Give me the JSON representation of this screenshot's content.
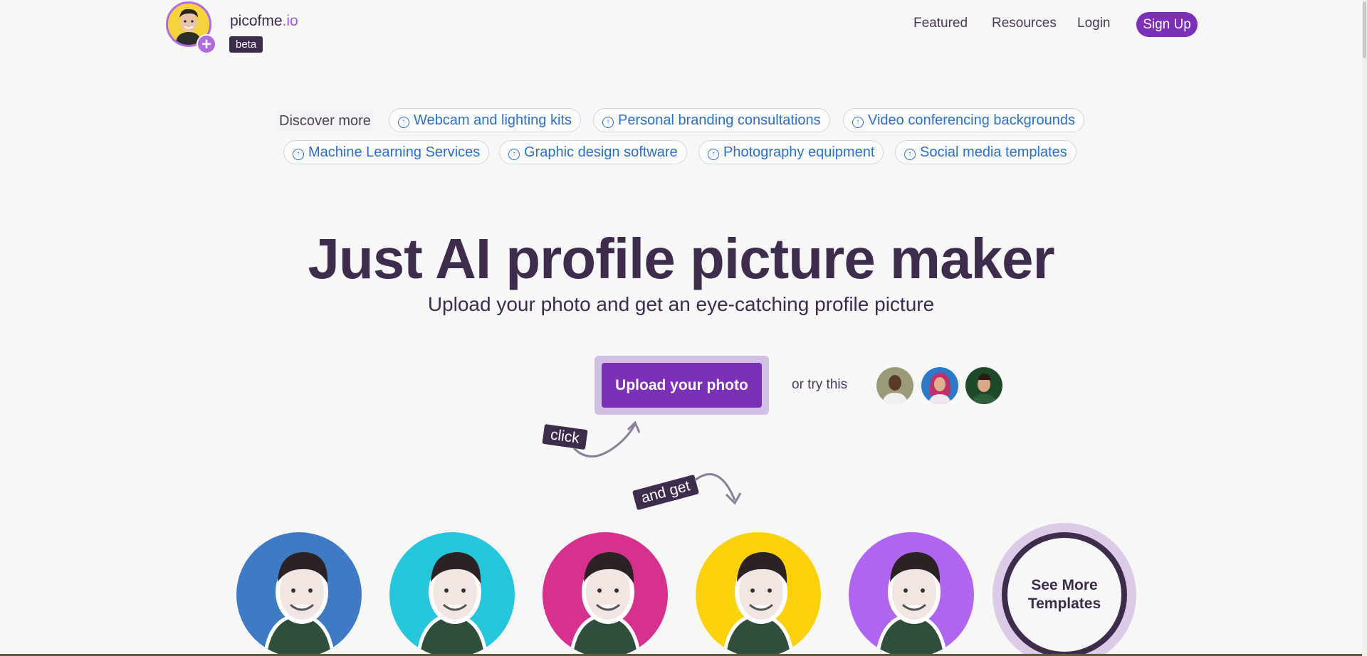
{
  "header": {
    "brand_name": "picofme",
    "brand_tld": ".io",
    "beta_label": "beta",
    "nav": [
      "Featured",
      "Resources",
      "Login"
    ],
    "signup_label": "Sign Up"
  },
  "discover": {
    "label": "Discover more",
    "chips": [
      "Webcam and lighting kits",
      "Personal branding consultations",
      "Video conferencing backgrounds",
      "Machine Learning Services",
      "Graphic design software",
      "Photography equipment",
      "Social media templates"
    ]
  },
  "hero": {
    "title": "Just AI profile picture maker",
    "subtitle": "Upload your photo and get an eye-catching profile picture",
    "upload_label": "Upload your photo",
    "or_try": "or try this",
    "click_tag": "click",
    "and_get_tag": "and get"
  },
  "templates": {
    "colors": [
      "#3f7bc5",
      "#25c6dc",
      "#d8308e",
      "#fbd20a",
      "#b065f0"
    ],
    "see_more_label": "See More Templates"
  },
  "colors": {
    "accent": "#7c30b8",
    "link": "#2b6fd1",
    "text": "#3e2c4d"
  }
}
